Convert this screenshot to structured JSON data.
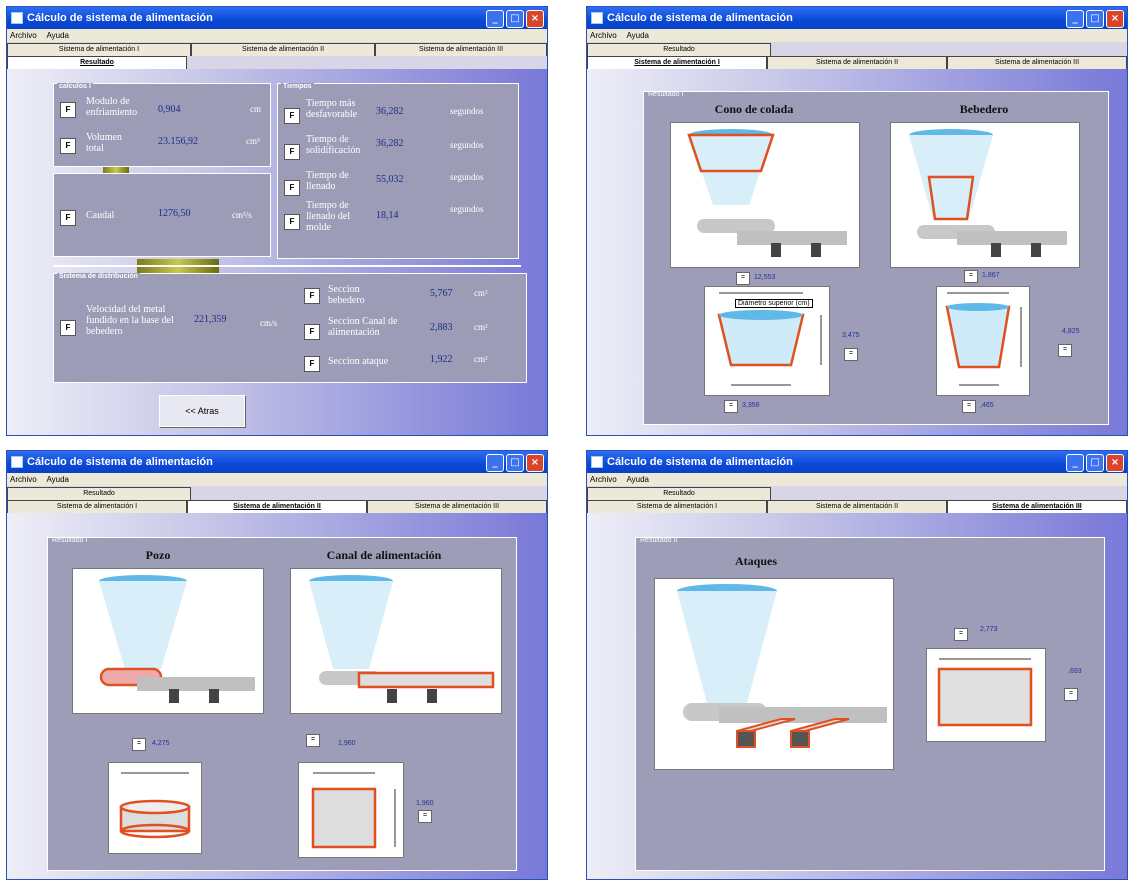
{
  "app": {
    "title": "Cálculo de sistema de alimentación",
    "menu": [
      "Archivo",
      "Ayuda"
    ]
  },
  "tabs": {
    "resultado": "Resultado",
    "s1": "Sistema de alimentación I",
    "s2": "Sistema de alimentación II",
    "s3": "Sistema de alimentación III",
    "s1_top": "Sistema de alimentación I",
    "s2_top": "Sistema de alimentación II",
    "s3_top": "Sistema de alimentación III"
  },
  "win1": {
    "calculos": {
      "label": "calculos I",
      "rows": [
        {
          "btn": "F",
          "label": "Modulo de enfriamiento",
          "value": "0,904",
          "unit": "cm"
        },
        {
          "btn": "F",
          "label": "Volumen total",
          "value": "23.156,92",
          "unit": "cm³"
        }
      ]
    },
    "caudal": {
      "btn": "F",
      "label": "Caudal",
      "value": "1276,50",
      "unit": "cm³/s"
    },
    "tiempos": {
      "label": "Tiempos",
      "rows": [
        {
          "btn": "F",
          "label": "Tiempo más desfavorable",
          "value": "36,282",
          "unit": "segundos"
        },
        {
          "btn": "F",
          "label": "Tiempo de solidificación",
          "value": "36,282",
          "unit": "segundos"
        },
        {
          "btn": "F",
          "label": "Tiempo de llenado",
          "value": "55,032",
          "unit": "segundos"
        },
        {
          "btn": "F",
          "label": "Tiempo de llenado del molde",
          "value": "18,14",
          "unit": "segundos"
        }
      ]
    },
    "sistema": {
      "label": "Sistema de distribución",
      "velocidad": {
        "btn": "F",
        "label": "Velocidad del metal fundido en la base del bebedero",
        "value": "221,359",
        "unit": "cm/s"
      },
      "rows": [
        {
          "btn": "F",
          "label": "Seccion bebedero",
          "value": "5,767",
          "unit": "cm²"
        },
        {
          "btn": "F",
          "label": "Seccion Canal de alimentación",
          "value": "2,883",
          "unit": "cm²"
        },
        {
          "btn": "F",
          "label": "Seccion ataque",
          "value": "1,922",
          "unit": "cm²"
        }
      ]
    },
    "atras": "<< Atras"
  },
  "win2": {
    "panel": "Resultado I",
    "h1": "Cono de colada",
    "h2": "Bebedero",
    "v1": "12,553",
    "v2": "1,867",
    "v3": "3,475",
    "v4": "3,358",
    "v5": "4,825",
    "v6": ",465",
    "tooltip": "Diámetro superior (cm)"
  },
  "win3": {
    "panel": "Resultado I",
    "h1": "Pozo",
    "h2": "Canal de alimentación",
    "v1": "4,275",
    "v2": "1,960",
    "v3": "1,960"
  },
  "win4": {
    "panel": "Resultado II",
    "h1": "Ataques",
    "v1": "2,773",
    "v2": ",693"
  },
  "colors": {
    "title": "#0a49d8",
    "highlight": "#e05020",
    "cup": "#5fb8e8",
    "panel": "#9d9db8"
  }
}
